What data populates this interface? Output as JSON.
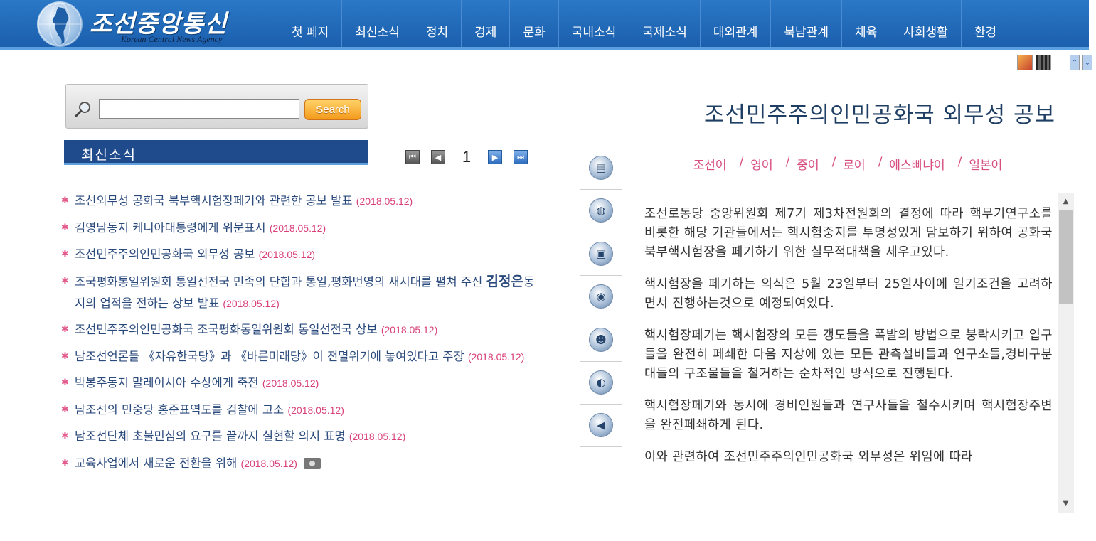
{
  "header": {
    "logo_title": "조선중앙통신",
    "logo_subtitle": "Korean Central News Agency",
    "nav": [
      "첫 페지",
      "최신소식",
      "정치",
      "경제",
      "문화",
      "국내소식",
      "국제소식",
      "대외관계",
      "북남관계",
      "체육",
      "사회생활",
      "환경"
    ]
  },
  "search": {
    "value": "",
    "button_label": "Search"
  },
  "news": {
    "heading": "최신소식",
    "page": "1",
    "items": [
      {
        "title": "조선외무성 공화국 북부핵시험장페기와 관련한 공보 발표",
        "date": "(2018.05.12)"
      },
      {
        "title": "김영남동지 케니아대통령에게 위문표시",
        "date": "(2018.05.12)"
      },
      {
        "title": "조선민주주의인민공화국 외무성 공보",
        "date": "(2018.05.12)"
      },
      {
        "title_pre": "조국평화통일위원회 통일선전국 민족의 단합과 통일,평화번영의 새시대를 펼쳐 주신 ",
        "title_leader": "김정은",
        "title_post": "동지의 업적을 전하는 상보 발표",
        "date": "(2018.05.12)"
      },
      {
        "title": "조선민주주의인민공화국 조국평화통일위원회 통일선전국 상보",
        "date": "(2018.05.12)"
      },
      {
        "title": "남조선언론들 《자유한국당》과 《바른미래당》이 전멸위기에 놓여있다고 주장",
        "date": "(2018.05.12)"
      },
      {
        "title": "박봉주동지 말레이시아 수상에게 축전",
        "date": "(2018.05.12)"
      },
      {
        "title": "남조선의 민중당 홍준표역도를 검찰에 고소",
        "date": "(2018.05.12)"
      },
      {
        "title": "남조선단체 초불민심의 요구를 끝까지 실현할 의지 표명",
        "date": "(2018.05.12)"
      },
      {
        "title": "교육사업에서 새로운 전환을 위해",
        "date": "(2018.05.12)"
      }
    ]
  },
  "article": {
    "title": "조선민주주의인민공화국 외무성 공보",
    "languages": [
      "조선어",
      "영어",
      "중어",
      "로어",
      "에스빠냐어",
      "일본어"
    ],
    "lang_separator": "/",
    "paragraphs": [
      "조선로동당 중앙위원회 제7기 제3차전원회의 결정에 따라 핵무기연구소를 비롯한 해당 기관들에서는 핵시험중지를 투명성있게 담보하기 위하여 공화국 북부핵시험장을 페기하기 위한 실무적대책을 세우고있다.",
      "핵시험장을 페기하는 의식은 5월 23일부터 25일사이에 일기조건을 고려하면서 진행하는것으로 예정되여있다.",
      "핵시험장페기는 핵시험장의 모든 갱도들을 폭발의 방법으로 붕락시키고 입구들을 완전히 페쇄한 다음 지상에 있는 모든 관측설비들과 연구소들,경비구분대들의 구조물들을 철거하는 순차적인 방식으로 진행된다.",
      "핵시험장페기와 동시에 경비인원들과 연구사들을 철수시키며 핵시험장주변을 완전페쇄하게 된다.",
      "이와 관련하여 조선민주주의인민공화국 외무성은 위임에 따라"
    ]
  },
  "colors": {
    "header_blue": "#1b5fad",
    "accent_pink": "#d74d80",
    "news_header": "#1f4a8c",
    "search_orange": "#f39a1b"
  },
  "icons": {
    "top": [
      "photo-icon",
      "film-icon",
      "scroll-up-icon",
      "scroll-down-icon"
    ],
    "side_tools": [
      "document-icon",
      "globe-icon",
      "camera-icon",
      "reel-icon",
      "person-icon",
      "speaker-icon",
      "back-icon"
    ]
  }
}
